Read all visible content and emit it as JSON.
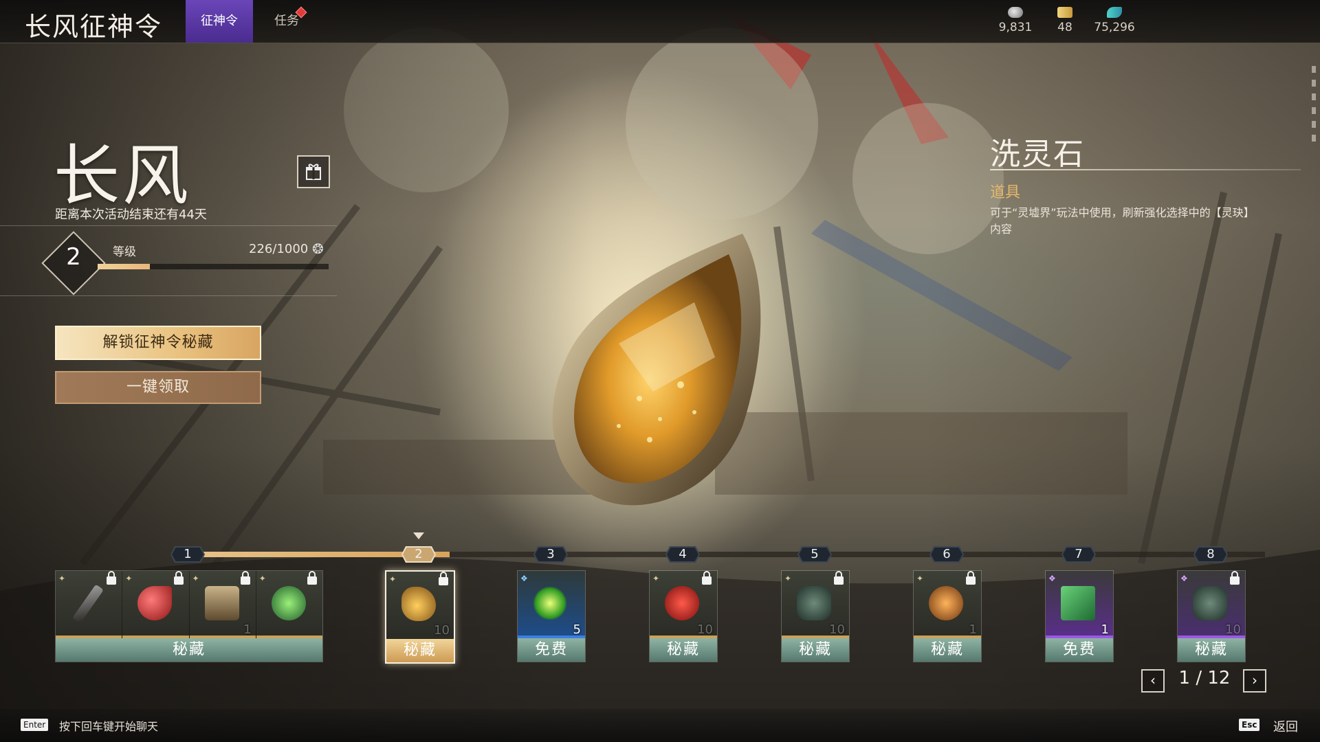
{
  "header": {
    "title": "长风征神令",
    "tabs": [
      {
        "label": "征神令",
        "active": true
      },
      {
        "label": "任务",
        "active": false,
        "has_notification": true
      }
    ],
    "currencies": [
      {
        "icon": "spirit-orb-icon",
        "value": "9,831"
      },
      {
        "icon": "ticket-icon",
        "value": "48"
      },
      {
        "icon": "feather-icon",
        "value": "75,296"
      }
    ]
  },
  "pass": {
    "name": "长风",
    "countdown": "距离本次活动结束还有44天",
    "level": "2",
    "level_label": "等级",
    "xp": "226/1000",
    "xp_progress": 0.226,
    "unlock_button": "解锁征神令秘藏",
    "claim_all_button": "一键领取"
  },
  "item_detail": {
    "name": "洗灵石",
    "type": "道具",
    "description": "可于“灵墟界”玩法中使用，刷新强化选择中的【灵玦】内容"
  },
  "reward_track": {
    "current_level": 2,
    "levels": [
      {
        "level": "1",
        "label": "秘藏",
        "items": [
          {
            "icon": "weapon-icon",
            "locked": true,
            "qty": ""
          },
          {
            "icon": "red-scale-icon",
            "locked": true,
            "qty": ""
          },
          {
            "icon": "chest-icon",
            "locked": true,
            "qty": "1"
          },
          {
            "icon": "green-plant-icon",
            "locked": true,
            "qty": ""
          }
        ]
      },
      {
        "level": "2",
        "label": "秘藏",
        "selected": true,
        "items": [
          {
            "icon": "spirit-stone-icon",
            "locked": true,
            "qty": "10"
          }
        ]
      },
      {
        "level": "3",
        "label": "免费",
        "items": [
          {
            "icon": "green-energy-icon",
            "locked": false,
            "qty": "5"
          }
        ]
      },
      {
        "level": "4",
        "label": "秘藏",
        "items": [
          {
            "icon": "red-orb-icon",
            "locked": true,
            "qty": "10"
          }
        ]
      },
      {
        "level": "5",
        "label": "秘藏",
        "items": [
          {
            "icon": "dice-gem-icon",
            "locked": true,
            "qty": "10"
          }
        ]
      },
      {
        "level": "6",
        "label": "秘藏",
        "items": [
          {
            "icon": "potion-icon",
            "locked": true,
            "qty": "1"
          }
        ]
      },
      {
        "level": "7",
        "label": "免费",
        "items": [
          {
            "icon": "card-pack-icon",
            "locked": false,
            "qty": "1"
          }
        ]
      },
      {
        "level": "8",
        "label": "秘藏",
        "items": [
          {
            "icon": "dice-gem-icon",
            "locked": true,
            "qty": "10"
          }
        ]
      }
    ]
  },
  "pager": {
    "text": "1 / 12"
  },
  "footer": {
    "chat_key": "Enter",
    "chat_hint": "按下回车键开始聊天",
    "back_key": "Esc",
    "back_label": "返回"
  },
  "colors": {
    "tab_active": "#5a37a3",
    "gold_accent": "#e6b86b",
    "premium_label": "#6f9486",
    "free_label": "#6f9486"
  }
}
